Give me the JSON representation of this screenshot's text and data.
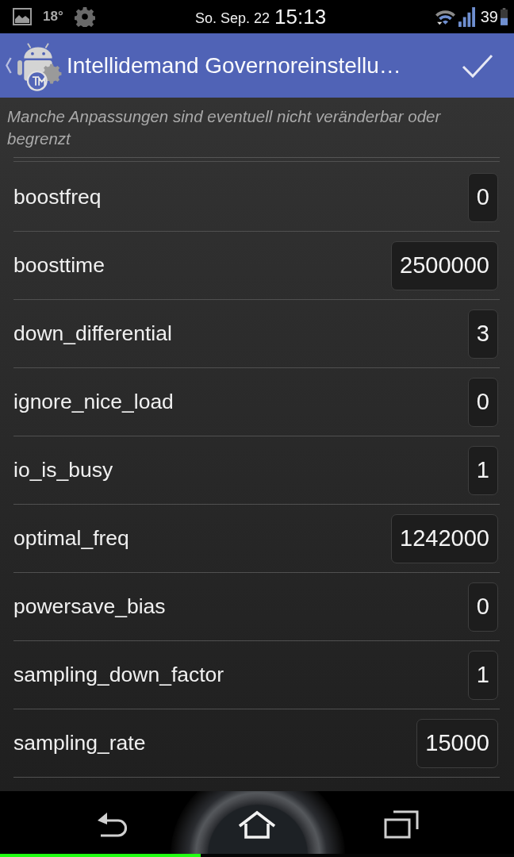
{
  "status_bar": {
    "temperature": "18°",
    "date": "So. Sep. 22",
    "time": "15:13",
    "battery": "39"
  },
  "action_bar": {
    "title": "Intellidemand Governoreinstellu…"
  },
  "note": "Manche Anpassungen sind eventuell nicht veränderbar oder begrenzt",
  "settings": [
    {
      "name": "boostfreq",
      "value": "0"
    },
    {
      "name": "boosttime",
      "value": "2500000"
    },
    {
      "name": "down_differential",
      "value": "3"
    },
    {
      "name": "ignore_nice_load",
      "value": "0"
    },
    {
      "name": "io_is_busy",
      "value": "1"
    },
    {
      "name": "optimal_freq",
      "value": "1242000"
    },
    {
      "name": "powersave_bias",
      "value": "0"
    },
    {
      "name": "sampling_down_factor",
      "value": "1"
    },
    {
      "name": "sampling_rate",
      "value": "15000"
    }
  ],
  "loading_bar": {
    "level": 0.39
  }
}
